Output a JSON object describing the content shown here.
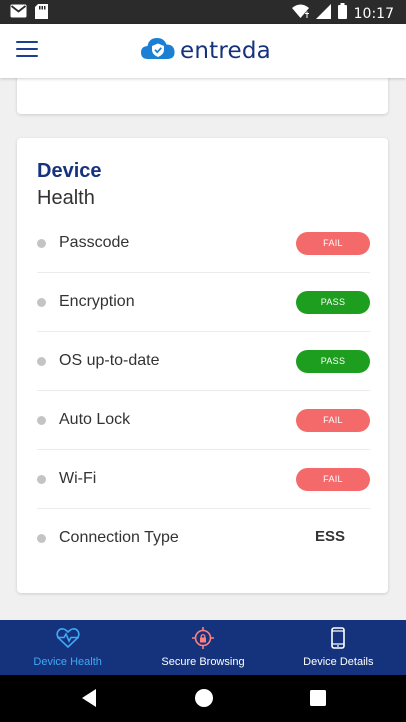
{
  "status_bar": {
    "time": "10:17",
    "icons": [
      "gmail-icon",
      "sd-card-icon",
      "wifi-icon",
      "signal-icon",
      "battery-icon"
    ]
  },
  "header": {
    "brand_name": "entreda",
    "menu_icon": "hamburger-menu-icon",
    "logo_icon": "cloud-shield-logo"
  },
  "device_health": {
    "title": "Device",
    "subtitle": "Health",
    "checks": [
      {
        "label": "Passcode",
        "status": "FAIL"
      },
      {
        "label": "Encryption",
        "status": "PASS"
      },
      {
        "label": "OS up-to-date",
        "status": "PASS"
      },
      {
        "label": "Auto Lock",
        "status": "FAIL"
      },
      {
        "label": "Wi-Fi",
        "status": "FAIL"
      },
      {
        "label": "Connection Type",
        "value": "ESS"
      }
    ]
  },
  "bottom_nav": {
    "items": [
      {
        "label": "Device Health",
        "icon": "heart-pulse-icon",
        "active": true
      },
      {
        "label": "Secure Browsing",
        "icon": "lock-target-icon",
        "active": false
      },
      {
        "label": "Device Details",
        "icon": "phone-icon",
        "active": false
      }
    ]
  },
  "system_nav": {
    "buttons": [
      "back-icon",
      "home-icon",
      "recents-icon"
    ]
  },
  "colors": {
    "brand_navy": "#15337c",
    "fail": "#f46a6a",
    "pass": "#1e9e1e",
    "active_tab": "#3fa9f5",
    "background": "#f0f0f0"
  }
}
